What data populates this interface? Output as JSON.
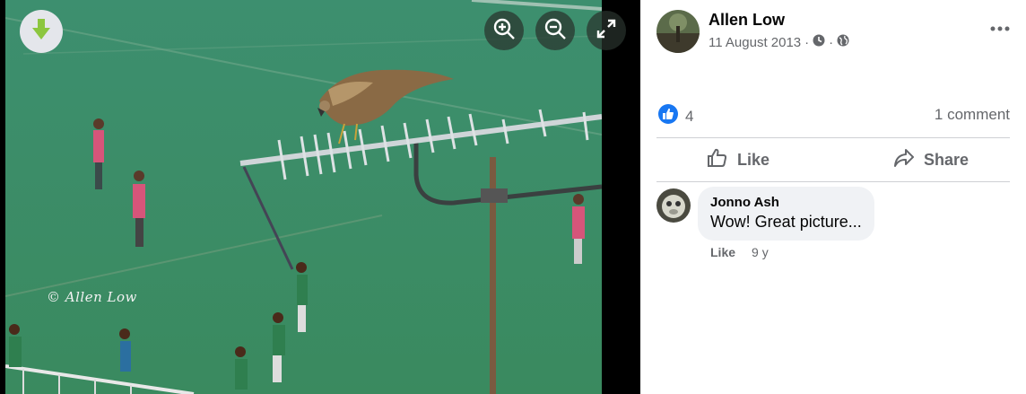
{
  "viewer": {
    "watermark": "© Allen Low",
    "icons": [
      "download-arrow-icon",
      "zoom-in-icon",
      "zoom-out-icon",
      "fullscreen-icon"
    ],
    "accent_color": "#8cc63f"
  },
  "post": {
    "author": "Allen Low",
    "date": "11 August 2013",
    "date_separator": "·",
    "reaction_count": "4",
    "comment_count": "1 comment",
    "like_label": "Like",
    "share_label": "Share",
    "like_icon_color": "#1877f2"
  },
  "comments": [
    {
      "author": "Jonno Ash",
      "text": "Wow! Great picture...",
      "like_label": "Like",
      "age": "9 y"
    }
  ]
}
